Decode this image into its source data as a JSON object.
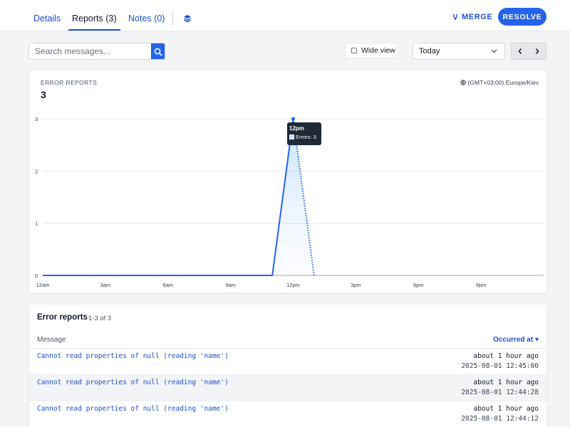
{
  "tabs": [
    {
      "label": "Details",
      "active": false
    },
    {
      "label": "Reports (3)",
      "active": true
    },
    {
      "label": "Notes (0)",
      "active": false
    }
  ],
  "actions": {
    "layers_icon": "layers-icon",
    "merge_label": "MERGE",
    "merge_icon": "merge-icon",
    "resolve_label": "RESOLVE"
  },
  "toolbar": {
    "search_placeholder": "Search messages...",
    "search_icon": "search-icon",
    "wide_view_label": "Wide view",
    "wide_view_checked": false,
    "period_value": "Today",
    "prev_icon": "chevron-left-icon",
    "next_icon": "chevron-right-icon"
  },
  "chart_card": {
    "label": "ERROR REPORTS",
    "total": "3",
    "timezone": "(GMT+03:00) Europe/Kiev",
    "timezone_icon": "globe-icon",
    "tooltip": {
      "title": "12pm",
      "text": "Errors: 3"
    }
  },
  "chart_data": {
    "type": "line",
    "x_ticks": [
      "12am",
      "3am",
      "6am",
      "9am",
      "12pm",
      "3pm",
      "6pm",
      "9pm"
    ],
    "y_ticks": [
      "0",
      "1",
      "2",
      "3"
    ],
    "ylim": [
      0,
      3
    ],
    "xlim_hours": [
      0,
      24
    ],
    "series": [
      {
        "values_solid": [
          [
            0,
            0
          ],
          [
            1,
            0
          ],
          [
            2,
            0
          ],
          [
            3,
            0
          ],
          [
            4,
            0
          ],
          [
            5,
            0
          ],
          [
            6,
            0
          ],
          [
            7,
            0
          ],
          [
            8,
            0
          ],
          [
            9,
            0
          ],
          [
            10,
            0
          ],
          [
            11,
            0
          ],
          [
            12,
            3
          ]
        ],
        "values_dotted": [
          [
            12,
            3
          ],
          [
            13,
            0
          ]
        ],
        "color": "#2563eb"
      }
    ],
    "grid": true
  },
  "list": {
    "title": "Error reports",
    "count": "1-3 of 3",
    "col_message": "Message",
    "col_occurred": "Occurred at ▾",
    "rows": [
      {
        "message": "Cannot read properties of null (reading 'name')",
        "relative": "about 1 hour ago",
        "timestamp": "2025-08-01 12:45:00"
      },
      {
        "message": "Cannot read properties of null (reading 'name')",
        "relative": "about 1 hour ago",
        "timestamp": "2025-08-01 12:44:28"
      },
      {
        "message": "Cannot read properties of null (reading 'name')",
        "relative": "about 1 hour ago",
        "timestamp": "2025-08-01 12:44:12"
      }
    ]
  }
}
